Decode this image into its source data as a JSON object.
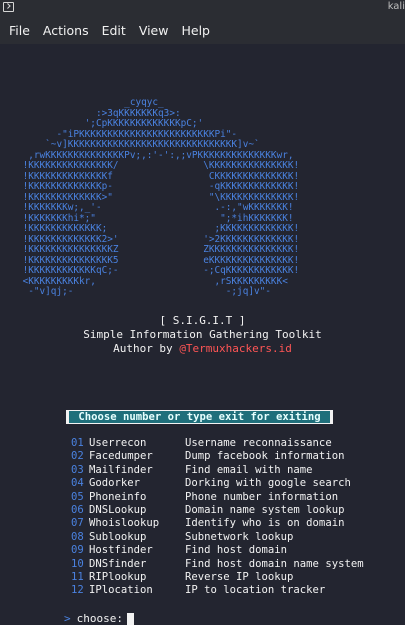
{
  "window": {
    "title": "kali"
  },
  "menubar": {
    "items": [
      "File",
      "Actions",
      "Edit",
      "View",
      "Help"
    ]
  },
  "banner": {
    "art_lines": [
      "                      _cyqyc_",
      "                 :>3qKKKKKKKq3>:",
      "               ';CpKKKKKKKKKKKKKpC;'",
      "          -\"iPKKKKKKKKKKKKKKKKKKKKKKKKPi\"-",
      "        `~v]KKKKKKKKKKKKKKKKKKKKKKKKKKKKKK]v~`",
      "     ,rwKKKKKKKKKKKKKKPv;,:'-':,;vPKKKKKKKKKKKKKKwr,",
      "    !KKKKKKKKKKKKKKK/               \\KKKKKKKKKKKKKKK!",
      "    !KKKKKKKKKKKKKKf                 CKKKKKKKKKKKKKK!",
      "    !KKKKKKKKKKKKKp-                 -qKKKKKKKKKKKKK!",
      "    !KKKKKKKKKKKKK>\"                 \"\\KKKKKKKKKKKKK!",
      "    !KKKKKKKw;,_'-                    .-:,\"wKKKKKKK!",
      "    !KKKKKKKhi*;\"                      \";*ihKKKKKKK!",
      "    !KKKKKKKKKKKKK;                   ;KKKKKKKKKKKKK!",
      "    !KKKKKKKKKKKKK2>'               '>2KKKKKKKKKKKKK!",
      "    !KKKKKKKKKKKKKKKZ               ZKKKKKKKKKKKKKKK!",
      "    !KKKKKKKKKKKKKKK5               eKKKKKKKKKKKKKKK!",
      "    !KKKKKKKKKKKKqC;-               -;CqKKKKKKKKKKKK!",
      "    <KKKKKKKKKkr,                     ,rSKKKKKKKKK<",
      "     -\"v]qj;-                           -;jq]v\"-"
    ],
    "toolkit_name": "[ S.I.G.I.T ]",
    "toolkit_full": "Simple Information Gathering Toolkit",
    "author_label": "Author by",
    "author_name": "@Termuxhackers.id"
  },
  "choose_banner": "Choose number or type exit for exiting",
  "menu": [
    {
      "num": "01",
      "tool": "Userrecon",
      "desc": "Username reconnaissance"
    },
    {
      "num": "02",
      "tool": "Facedumper",
      "desc": "Dump facebook information"
    },
    {
      "num": "03",
      "tool": "Mailfinder",
      "desc": "Find email with name"
    },
    {
      "num": "04",
      "tool": "Godorker",
      "desc": "Dorking with google search"
    },
    {
      "num": "05",
      "tool": "Phoneinfo",
      "desc": "Phone number information"
    },
    {
      "num": "06",
      "tool": "DNSLookup",
      "desc": "Domain name system lookup"
    },
    {
      "num": "07",
      "tool": "Whoislookup",
      "desc": "Identify who is on domain"
    },
    {
      "num": "08",
      "tool": "Sublookup",
      "desc": "Subnetwork lookup"
    },
    {
      "num": "09",
      "tool": "Hostfinder",
      "desc": "Find host domain"
    },
    {
      "num": "10",
      "tool": "DNSfinder",
      "desc": "Find host domain name system"
    },
    {
      "num": "11",
      "tool": "RIPlookup",
      "desc": "Reverse IP lookup"
    },
    {
      "num": "12",
      "tool": "IPlocation",
      "desc": "IP to location tracker"
    }
  ],
  "prompt": {
    "arrow": ">",
    "label": "choose:"
  }
}
